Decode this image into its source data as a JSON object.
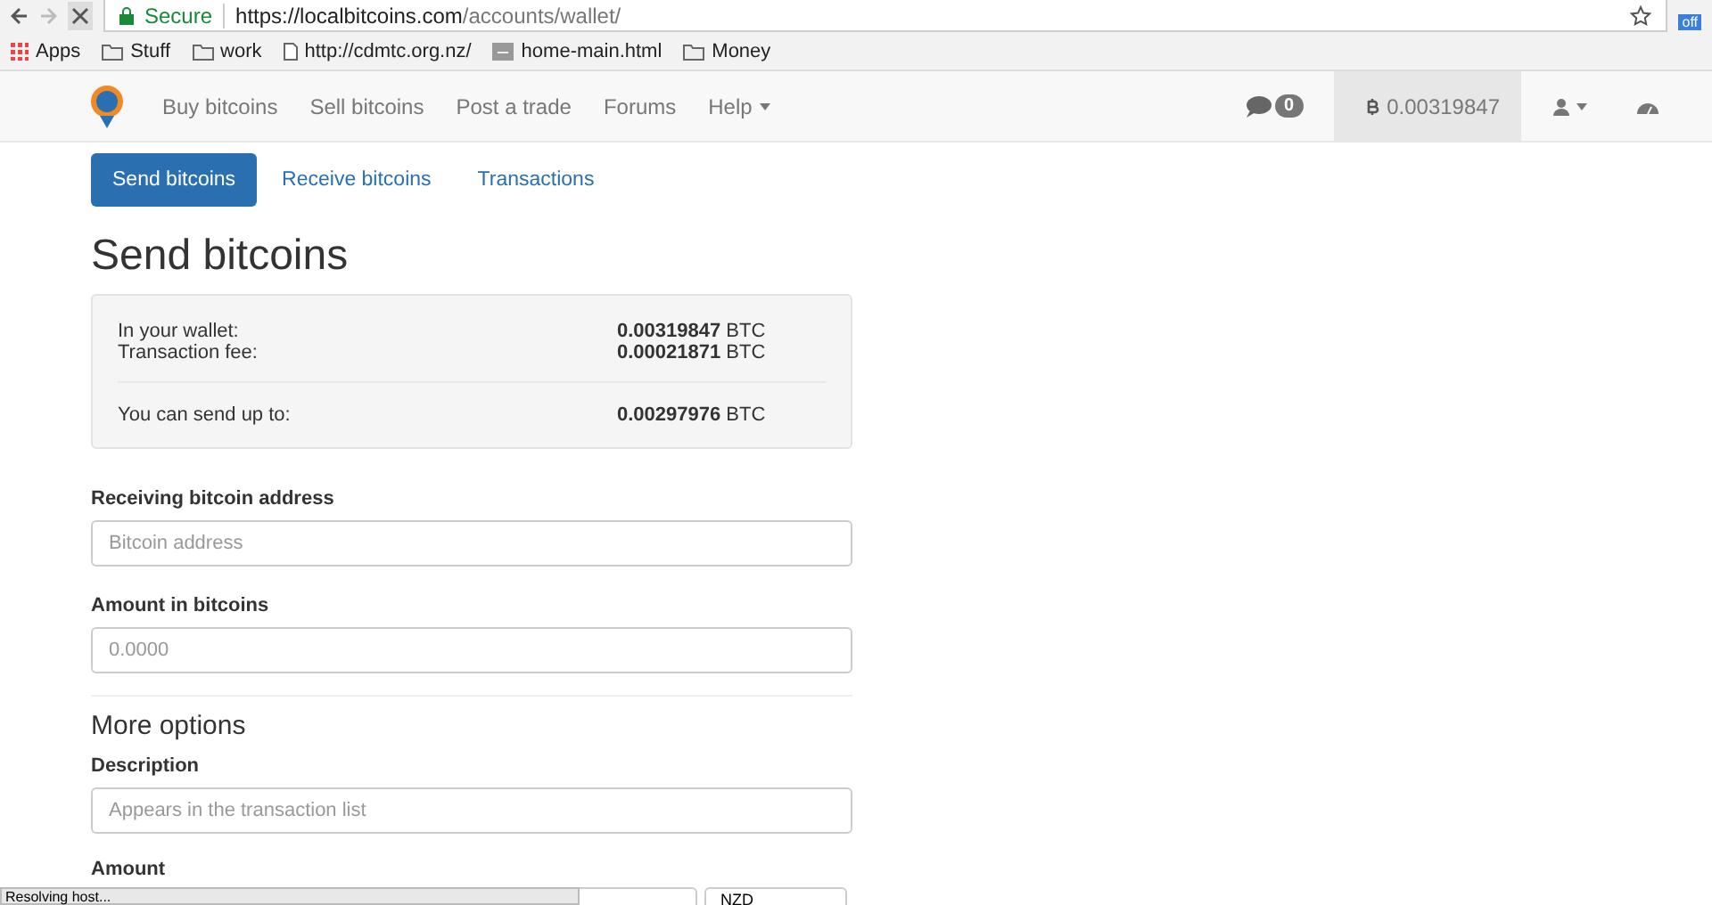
{
  "browser": {
    "secure_label": "Secure",
    "url_host": "https://localbitcoins.com",
    "url_path": "/accounts/wallet/",
    "extension_badge": "off",
    "bookmarks": [
      {
        "kind": "apps",
        "label": "Apps"
      },
      {
        "kind": "folder",
        "label": "Stuff"
      },
      {
        "kind": "folder",
        "label": "work"
      },
      {
        "kind": "page",
        "label": "http://cdmtc.org.nz/"
      },
      {
        "kind": "site",
        "label": "home-main.html"
      },
      {
        "kind": "folder",
        "label": "Money"
      }
    ]
  },
  "navbar": {
    "links": [
      {
        "label": "Buy bitcoins",
        "dropdown": false
      },
      {
        "label": "Sell bitcoins",
        "dropdown": false
      },
      {
        "label": "Post a trade",
        "dropdown": false
      },
      {
        "label": "Forums",
        "dropdown": false
      },
      {
        "label": "Help",
        "dropdown": true
      }
    ],
    "message_count": "0",
    "balance": "0.00319847"
  },
  "tabs": [
    {
      "label": "Send bitcoins",
      "selected": true
    },
    {
      "label": "Receive bitcoins",
      "selected": false
    },
    {
      "label": "Transactions",
      "selected": false
    }
  ],
  "heading": "Send bitcoins",
  "summary": [
    {
      "kind": "line",
      "label": "In your wallet:",
      "value": "**0.00319847** BTC"
    },
    {
      "kind": "line",
      "label": "Transaction fee:",
      "value": "**0.00021871** BTC"
    },
    {
      "kind": "total",
      "label": "You can send up to:",
      "value": "**0.00297976** BTC"
    }
  ],
  "fields": [
    {
      "label": "Receiving bitcoin address",
      "placeholder": "Bitcoin address"
    },
    {
      "label": "Amount in bitcoins",
      "placeholder": "0.0000"
    }
  ],
  "more_options": {
    "title": "More options",
    "fields": [
      {
        "label": "Description",
        "placeholder": "Appears in the transaction list"
      }
    ],
    "amount": {
      "label": "Amount",
      "currency": "NZD"
    }
  },
  "status": "Resolving host..."
}
